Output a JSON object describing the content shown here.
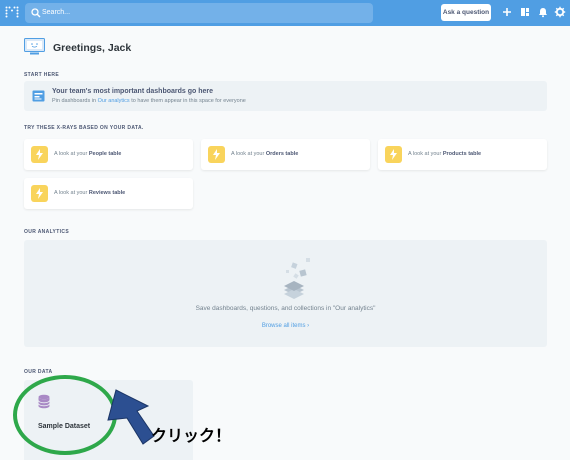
{
  "topbar": {
    "search_placeholder": "Search...",
    "ask_button": "Ask a question",
    "icons": [
      "metabase-logo",
      "search-icon",
      "plus-icon",
      "dashboard-icon",
      "bell-icon",
      "gear-icon"
    ]
  },
  "greeting": {
    "text": "Greetings, Jack"
  },
  "start_here": {
    "section_label": "START HERE",
    "title": "Your team's most important dashboards go here",
    "subtitle_before": "Pin dashboards in ",
    "subtitle_link": "Our analytics",
    "subtitle_after": " to have them appear in this space for everyone"
  },
  "xrays": {
    "section_label": "TRY THESE X-RAYS BASED ON YOUR DATA.",
    "prefix": "A look at your ",
    "cards": [
      {
        "table": "People table"
      },
      {
        "table": "Orders table"
      },
      {
        "table": "Products table"
      },
      {
        "table": "Reviews table"
      }
    ]
  },
  "analytics": {
    "section_label": "OUR ANALYTICS",
    "empty_text": "Save dashboards, questions, and collections in \"Our analytics\"",
    "browse_link": "Browse all items"
  },
  "our_data": {
    "section_label": "OUR DATA",
    "dataset": "Sample Dataset"
  },
  "annotation": {
    "text": "クリック！",
    "ring_color": "#2ea84a",
    "arrow_color": "#2c4f91"
  },
  "colors": {
    "brand": "#509ee3",
    "bolt": "#f9d45c",
    "database": "#a989c5"
  }
}
